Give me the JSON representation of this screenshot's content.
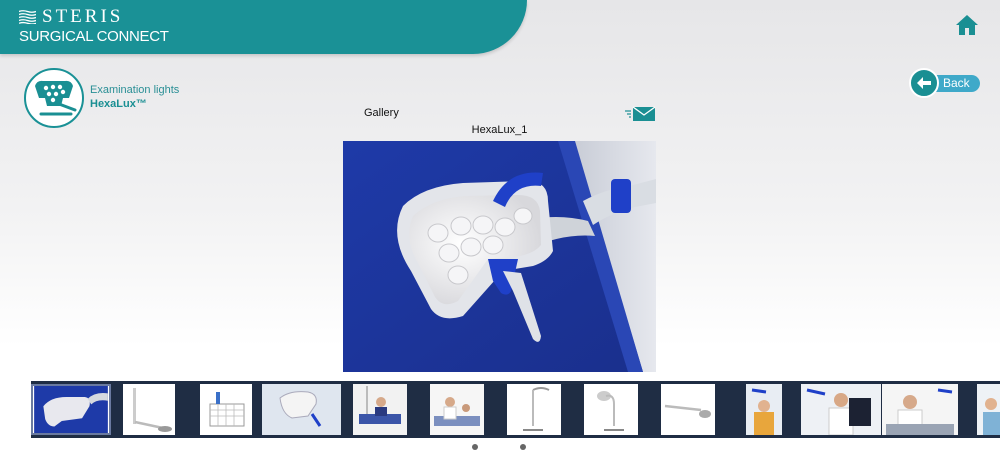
{
  "header": {
    "brand": "STERIS",
    "subtitle": "SURGICAL CONNECT",
    "colors": {
      "banner": "#1a9196",
      "accent": "#3fa9c9"
    }
  },
  "nav": {
    "home_icon": "home-icon",
    "back_label": "Back",
    "back_icon": "arrow-left-icon"
  },
  "product": {
    "category": "Examination lights",
    "name": "HexaLux™",
    "badge_icon": "examination-light-icon"
  },
  "gallery": {
    "label": "Gallery",
    "mail_icon": "email-icon",
    "current_title": "HexaLux_1",
    "thumbnails": [
      {
        "id": "thumb-1",
        "subject": "light head close-up",
        "active": true
      },
      {
        "id": "thumb-2",
        "subject": "wall arm mount"
      },
      {
        "id": "thumb-3",
        "subject": "basket accessory"
      },
      {
        "id": "thumb-4",
        "subject": "light head in room"
      },
      {
        "id": "thumb-5",
        "subject": "light at bedside"
      },
      {
        "id": "thumb-6",
        "subject": "doctor with patient"
      },
      {
        "id": "thumb-7",
        "subject": "mobile stand"
      },
      {
        "id": "thumb-8",
        "subject": "mobile stand variant"
      },
      {
        "id": "thumb-9",
        "subject": "wall mount side view"
      },
      {
        "id": "thumb-10",
        "subject": "nurse with light"
      },
      {
        "id": "thumb-11",
        "subject": "doctor with x-ray"
      },
      {
        "id": "thumb-12",
        "subject": "doctor at desk"
      },
      {
        "id": "thumb-13",
        "subject": "nurse portrait"
      }
    ],
    "page_dots": 2,
    "current_page": 1
  }
}
